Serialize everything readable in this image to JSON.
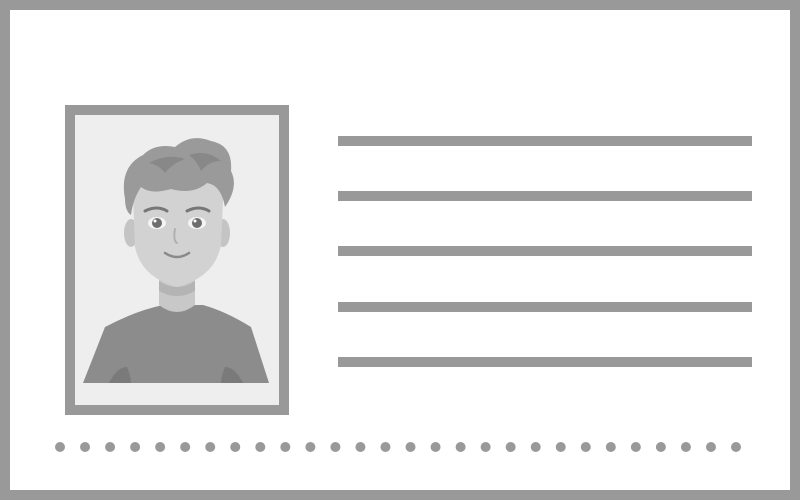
{
  "card": {
    "border_color": "#999999",
    "background_color": "#ffffff",
    "photo_background": "#eeeeee",
    "photo_icon": "person-portrait-icon",
    "text_line_count": 5,
    "dot_count": 28
  }
}
